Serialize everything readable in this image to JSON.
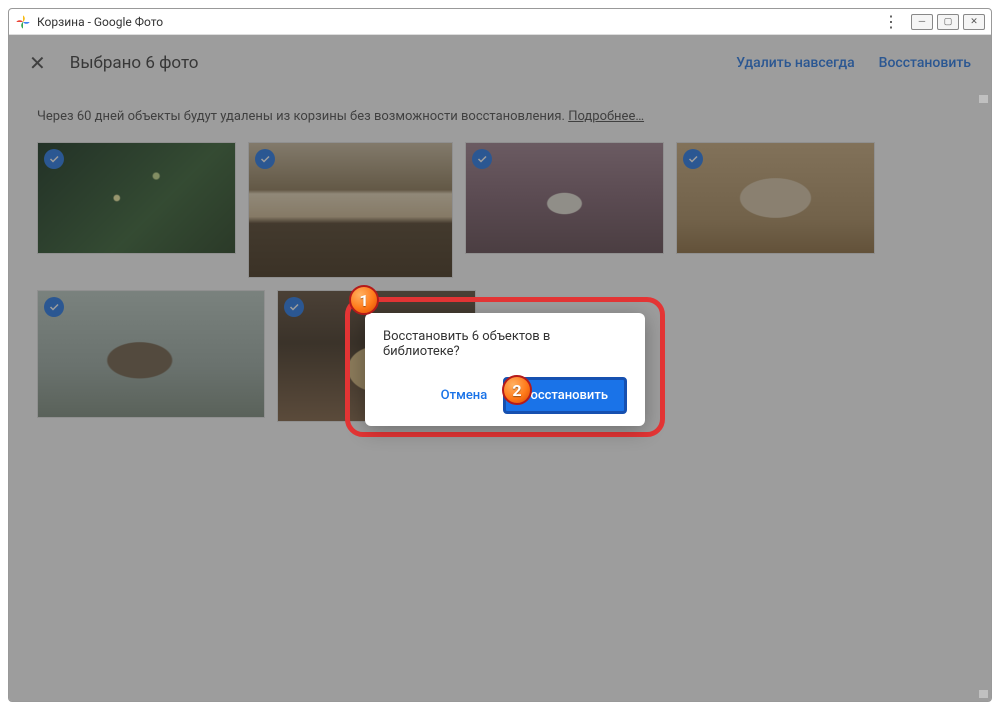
{
  "window": {
    "title": "Корзина - Google Фото"
  },
  "toolbar": {
    "selection": "Выбрано 6 фото",
    "delete_forever": "Удалить навсегда",
    "restore": "Восстановить"
  },
  "notice": {
    "text": "Через 60 дней объекты будут удалены из корзины без возможности восстановления. ",
    "more": "Подробнее…"
  },
  "dialog": {
    "message": "Восстановить 6 объектов в библиотеке?",
    "cancel": "Отмена",
    "confirm": "Восстановить"
  },
  "callouts": {
    "one": "1",
    "two": "2"
  }
}
